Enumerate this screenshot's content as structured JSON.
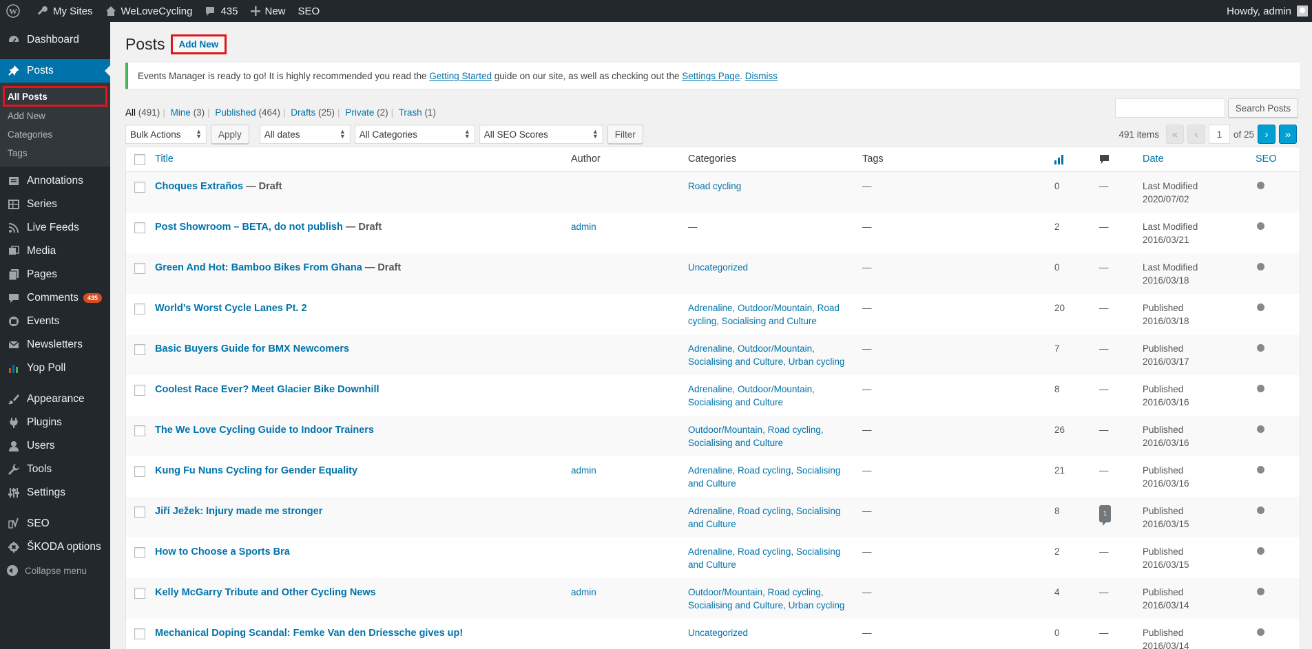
{
  "adminbar": {
    "my_sites": "My Sites",
    "site_name": "WeLoveCycling",
    "comments_count": "435",
    "new": "New",
    "seo": "SEO",
    "howdy": "Howdy, admin"
  },
  "sidebar": {
    "dashboard": "Dashboard",
    "posts": "Posts",
    "sub_all_posts": "All Posts",
    "sub_add_new": "Add New",
    "sub_categories": "Categories",
    "sub_tags": "Tags",
    "annotations": "Annotations",
    "series": "Series",
    "live_feeds": "Live Feeds",
    "media": "Media",
    "pages": "Pages",
    "comments": "Comments",
    "comments_badge": "435",
    "events": "Events",
    "newsletters": "Newsletters",
    "yop_poll": "Yop Poll",
    "appearance": "Appearance",
    "plugins": "Plugins",
    "users": "Users",
    "tools": "Tools",
    "settings": "Settings",
    "seo": "SEO",
    "skoda": "ŠKODA options",
    "collapse": "Collapse menu"
  },
  "page": {
    "title": "Posts",
    "add_new": "Add New"
  },
  "notice": {
    "text1": "Events Manager is ready to go! It is highly recommended you read the ",
    "link1": "Getting Started",
    "text2": " guide on our site, as well as checking out the ",
    "link2": "Settings Page",
    "text3": ". ",
    "dismiss": "Dismiss"
  },
  "views": {
    "all": "All",
    "all_count": "(491)",
    "mine": "Mine",
    "mine_count": "(3)",
    "published": "Published",
    "published_count": "(464)",
    "drafts": "Drafts",
    "drafts_count": "(25)",
    "private": "Private",
    "private_count": "(2)",
    "trash": "Trash",
    "trash_count": "(1)",
    "sep": "|"
  },
  "search": {
    "button": "Search Posts",
    "placeholder": ""
  },
  "filters": {
    "bulk_actions": "Bulk Actions",
    "apply": "Apply",
    "dates": "All dates",
    "categories": "All Categories",
    "seo_scores": "All SEO Scores",
    "filter": "Filter"
  },
  "pagination": {
    "items": "491 items",
    "first": "«",
    "prev": "‹",
    "current": "1",
    "of": "of 25",
    "next": "›",
    "last": "»"
  },
  "table": {
    "headers": {
      "title": "Title",
      "author": "Author",
      "categories": "Categories",
      "tags": "Tags",
      "date": "Date",
      "seo": "SEO"
    },
    "rows": [
      {
        "title": "Choques Extraños",
        "state": " — Draft",
        "author": "",
        "cats1": "Road cycling",
        "cats2": "",
        "tags": "—",
        "stats": "0",
        "comments": "—",
        "date_label": "Last Modified",
        "date": "2020/07/02"
      },
      {
        "title": "Post Showroom – BETA, do not publish",
        "state": " — Draft",
        "author": "admin",
        "cats1": "—",
        "cats2": "",
        "tags": "—",
        "stats": "2",
        "comments": "—",
        "date_label": "Last Modified",
        "date": "2016/03/21"
      },
      {
        "title": "Green And Hot: Bamboo Bikes From Ghana",
        "state": " — Draft",
        "author": "",
        "cats1": "Uncategorized",
        "cats2": "",
        "tags": "—",
        "stats": "0",
        "comments": "—",
        "date_label": "Last Modified",
        "date": "2016/03/18"
      },
      {
        "title": "World’s Worst Cycle Lanes Pt. 2",
        "state": "",
        "author": "",
        "cats1": "Adrenaline, Outdoor/Mountain, Road",
        "cats2": "cycling, Socialising and Culture",
        "tags": "—",
        "stats": "20",
        "comments": "—",
        "date_label": "Published",
        "date": "2016/03/18"
      },
      {
        "title": "Basic Buyers Guide for BMX Newcomers",
        "state": "",
        "author": "",
        "cats1": "Adrenaline, Outdoor/Mountain,",
        "cats2": "Socialising and Culture, Urban cycling",
        "tags": "—",
        "stats": "7",
        "comments": "—",
        "date_label": "Published",
        "date": "2016/03/17"
      },
      {
        "title": "Coolest Race Ever? Meet Glacier Bike Downhill",
        "state": "",
        "author": "",
        "cats1": "Adrenaline, Outdoor/Mountain,",
        "cats2": "Socialising and Culture",
        "tags": "—",
        "stats": "8",
        "comments": "—",
        "date_label": "Published",
        "date": "2016/03/16"
      },
      {
        "title": "The We Love Cycling Guide to Indoor Trainers",
        "state": "",
        "author": "",
        "cats1": "Outdoor/Mountain, Road cycling,",
        "cats2": "Socialising and Culture",
        "tags": "—",
        "stats": "26",
        "comments": "—",
        "date_label": "Published",
        "date": "2016/03/16"
      },
      {
        "title": "Kung Fu Nuns Cycling for Gender Equality",
        "state": "",
        "author": "admin",
        "cats1": "Adrenaline, Road cycling, Socialising",
        "cats2": "and Culture",
        "tags": "—",
        "stats": "21",
        "comments": "—",
        "date_label": "Published",
        "date": "2016/03/16"
      },
      {
        "title": "Jiří Ježek: Injury made me stronger",
        "state": "",
        "author": "",
        "cats1": "Adrenaline, Road cycling, Socialising",
        "cats2": "and Culture",
        "tags": "—",
        "stats": "8",
        "comments": "1",
        "date_label": "Published",
        "date": "2016/03/15"
      },
      {
        "title": "How to Choose a Sports Bra",
        "state": "",
        "author": "",
        "cats1": "Adrenaline, Road cycling, Socialising",
        "cats2": "and Culture",
        "tags": "—",
        "stats": "2",
        "comments": "—",
        "date_label": "Published",
        "date": "2016/03/15"
      },
      {
        "title": "Kelly McGarry Tribute and Other Cycling News",
        "state": "",
        "author": "admin",
        "cats1": "Outdoor/Mountain, Road cycling,",
        "cats2": "Socialising and Culture, Urban cycling",
        "tags": "—",
        "stats": "4",
        "comments": "—",
        "date_label": "Published",
        "date": "2016/03/14"
      },
      {
        "title": "Mechanical Doping Scandal: Femke Van den Driessche gives up!",
        "state": "",
        "author": "",
        "cats1": "Uncategorized",
        "cats2": "",
        "tags": "—",
        "stats": "0",
        "comments": "—",
        "date_label": "Published",
        "date": "2016/03/14"
      }
    ]
  },
  "colors": {
    "accent": "#0073aa",
    "highlight": "#e0161c",
    "sidebar": "#23282d"
  }
}
